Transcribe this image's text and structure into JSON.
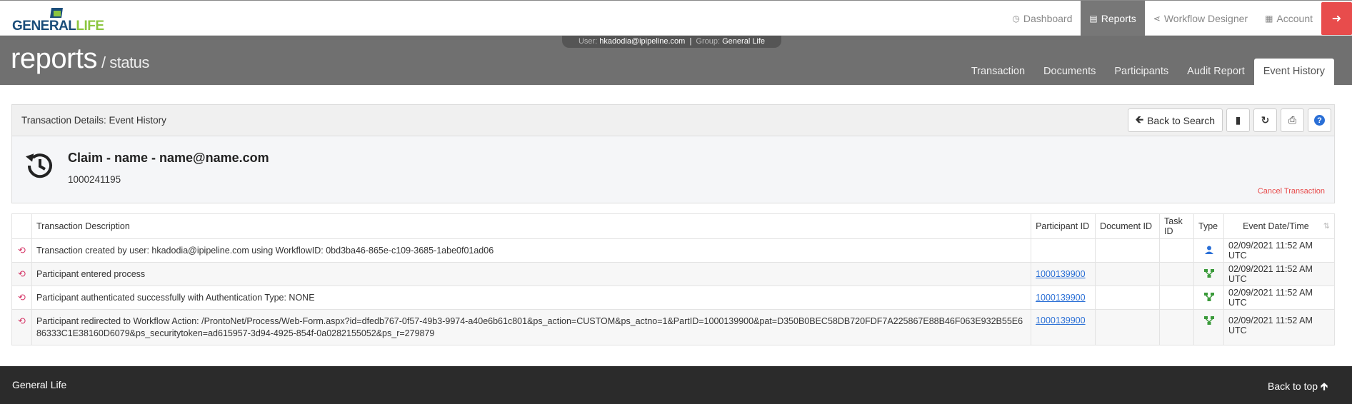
{
  "brand": {
    "left": "GENERAL",
    "right": "LIFE"
  },
  "nav": {
    "items": [
      {
        "label": "Dashboard",
        "icon": "dashboard-icon",
        "active": false
      },
      {
        "label": "Reports",
        "icon": "chart-icon",
        "active": true
      },
      {
        "label": "Workflow Designer",
        "icon": "workflow-icon",
        "active": false
      },
      {
        "label": "Account",
        "icon": "account-icon",
        "active": false
      }
    ],
    "logout_icon": "logout-icon"
  },
  "user_bar": {
    "user_label": "User:",
    "user": "hkadodia@ipipeline.com",
    "sep": "|",
    "group_label": "Group:",
    "group": "General Life"
  },
  "page": {
    "title": "reports",
    "subtitle": "/ status"
  },
  "tabs": [
    "Transaction",
    "Documents",
    "Participants",
    "Audit Report",
    "Event History"
  ],
  "active_tab": "Event History",
  "panel": {
    "heading": "Transaction Details: Event History",
    "back_label": "Back to Search",
    "claim_title": "Claim - name - name@name.com",
    "claim_id": "1000241195",
    "cancel_label": "Cancel Transaction"
  },
  "table": {
    "headers": [
      "Transaction Description",
      "Participant ID",
      "Document ID",
      "Task ID",
      "Type",
      "Event Date/Time"
    ],
    "rows": [
      {
        "desc": "Transaction created by user: hkadodia@ipipeline.com using WorkflowID: 0bd3ba46-865e-c109-3685-1abe0f01ad06",
        "participant": "",
        "document": "",
        "task": "",
        "type": "user-icon",
        "date": "02/09/2021 11:52 AM UTC"
      },
      {
        "desc": "Participant entered process",
        "participant": "1000139900",
        "document": "",
        "task": "",
        "type": "workflow-icon",
        "date": "02/09/2021 11:52 AM UTC"
      },
      {
        "desc": "Participant authenticated successfully with Authentication Type: NONE",
        "participant": "1000139900",
        "document": "",
        "task": "",
        "type": "workflow-icon",
        "date": "02/09/2021 11:52 AM UTC"
      },
      {
        "desc": "Participant redirected to Workflow Action: /ProntoNet/Process/Web-Form.aspx?id=dfedb767-0f57-49b3-9974-a40e6b61c801&ps_action=CUSTOM&ps_actno=1&PartID=1000139900&pat=D350B0BEC58DB720FDF7A225867E88B46F063E932B55E686333C1E38160D6079&ps_securitytoken=ad615957-3d94-4925-854f-0a0282155052&ps_r=279879",
        "participant": "1000139900",
        "document": "",
        "task": "",
        "type": "workflow-icon",
        "date": "02/09/2021 11:52 AM UTC"
      }
    ]
  },
  "footer": {
    "left": "General Life",
    "right": "Back to top"
  },
  "colors": {
    "accent": "#e84c4c",
    "header": "#707070",
    "link": "#2a6fd6",
    "brand_blue": "#1a4d7a",
    "brand_green": "#8cc63f",
    "type_user": "#2a6fd6",
    "type_workflow": "#3a9a3a"
  }
}
